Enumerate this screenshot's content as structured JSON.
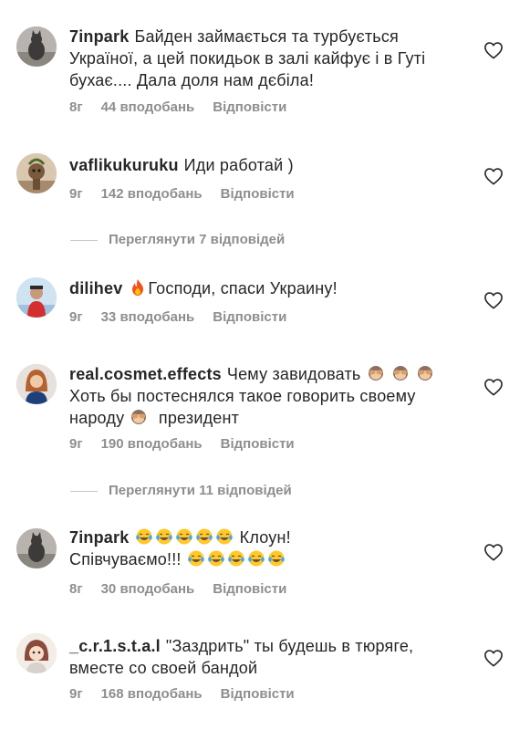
{
  "comments": [
    {
      "username": "7inpark",
      "text": "Байден займається та турбується Україної, а цей покидьок в залі кайфує і в Гуті бухає.... Дала доля нам дєбіла!",
      "time": "8г",
      "likes": "44 вподобань",
      "reply": "Відповісти",
      "avatar": "cat-avatar-icon"
    },
    {
      "username": "vaflikukuruku",
      "text": "Иди работай )",
      "time": "9г",
      "likes": "142 вподобань",
      "reply": "Відповісти",
      "avatar": "plant-character-avatar-icon"
    },
    {
      "username": "dilihev",
      "text_after_emoji": "Господи, спаси Украину!",
      "emoji": "fire-emoji-icon",
      "time": "9г",
      "likes": "33 вподобань",
      "reply": "Відповісти",
      "avatar": "man-red-shirt-avatar-icon"
    },
    {
      "username": "real.cosmet.effects",
      "text_part1": "Чему завидовать",
      "text_part2": "Хоть бы постеснялся такое говорить своему народу",
      "text_part3": "президент",
      "emoji": "see-no-evil-monkey-emoji-icon",
      "time": "9г",
      "likes": "190 вподобань",
      "reply": "Відповісти",
      "avatar": "woman-avatar-icon"
    },
    {
      "username": "7inpark",
      "text_part1": "Клоун!",
      "text_part2": "Співчуваємо!!!",
      "emoji": "tears-of-joy-emoji-icon",
      "time": "8г",
      "likes": "30 вподобань",
      "reply": "Відповісти",
      "avatar": "cat-avatar-icon"
    },
    {
      "username": "_c.r.1.s.t.a.l",
      "text": "\"Заздрить\" ты будешь в тюряге, вместе со своей бандой",
      "time": "9г",
      "likes": "168 вподобань",
      "reply": "Відповісти",
      "avatar": "anime-character-avatar-icon"
    }
  ],
  "view_replies": [
    "Переглянути 7 відповідей",
    "Переглянути 11 відповідей"
  ],
  "colors": {
    "text": "#262626",
    "secondary": "#8e8e8e",
    "background": "#ffffff"
  }
}
